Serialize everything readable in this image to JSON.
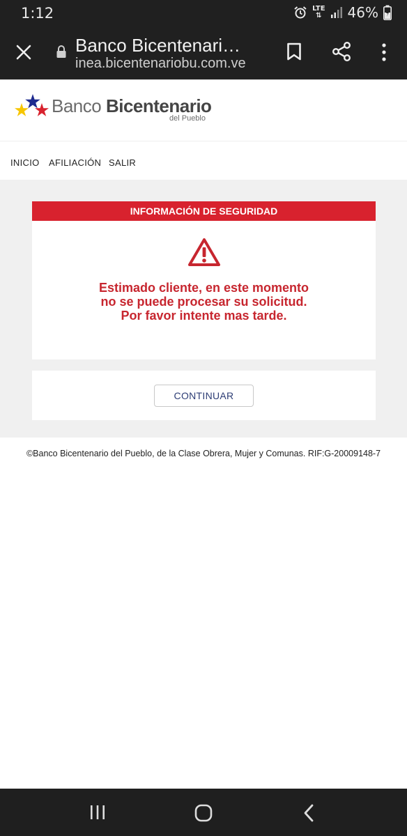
{
  "status_bar": {
    "time": "1:12",
    "network": "LTE",
    "battery": "46%"
  },
  "browser": {
    "page_title": "Banco Bicentenari…",
    "url": "inea.bicentenariobu.com.ve"
  },
  "site": {
    "logo_main_light": "Banco ",
    "logo_main_bold": "Bicentenario",
    "logo_sub": "del Pueblo"
  },
  "nav": {
    "items": [
      "INICIO",
      "AFILIACIÓN",
      "SALIR"
    ]
  },
  "security_panel": {
    "header": "INFORMACIÓN DE SEGURIDAD",
    "message": "Estimado cliente, en este momento no se puede procesar su solicitud. Por favor intente mas tarde."
  },
  "actions": {
    "continue_label": "CONTINUAR"
  },
  "footer": {
    "text": "©Banco Bicentenario del Pueblo, de la Clase Obrera, Mujer y Comunas. RIF:G-20009148-7"
  },
  "colors": {
    "alert_red": "#d8222e",
    "message_red": "#c7262f",
    "button_text": "#2d3d75",
    "chrome_dark": "#202020",
    "star_blue": "#1f2b8f",
    "star_yellow": "#f7c600",
    "star_red": "#d8222e"
  }
}
